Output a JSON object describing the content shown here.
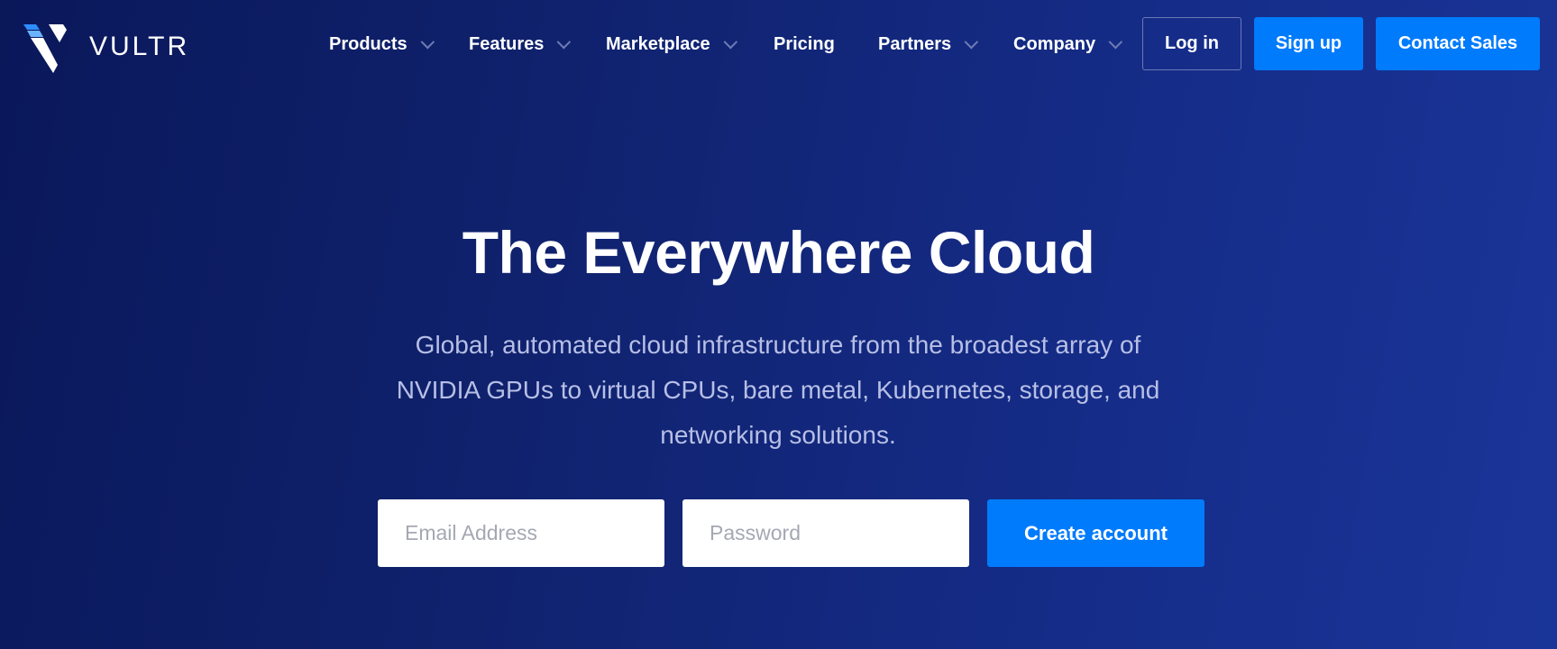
{
  "brand": {
    "name": "VULTR",
    "icon": "vultr-logo-icon"
  },
  "nav": {
    "items": [
      {
        "label": "Products",
        "dropdown": true
      },
      {
        "label": "Features",
        "dropdown": true
      },
      {
        "label": "Marketplace",
        "dropdown": true
      },
      {
        "label": "Pricing",
        "dropdown": false
      },
      {
        "label": "Partners",
        "dropdown": true
      },
      {
        "label": "Company",
        "dropdown": true
      }
    ],
    "login_label": "Log in",
    "signup_label": "Sign up",
    "contact_label": "Contact Sales"
  },
  "hero": {
    "title": "The Everywhere Cloud",
    "subtitle": "Global, automated cloud infrastructure from the broadest array of NVIDIA GPUs to virtual CPUs, bare metal, Kubernetes, storage, and networking solutions.",
    "email_placeholder": "Email Address",
    "password_placeholder": "Password",
    "email_value": "",
    "password_value": "",
    "cta_label": "Create account"
  },
  "colors": {
    "accent": "#007bfc",
    "bg_left": "#0a185a",
    "bg_right": "#1a3599"
  }
}
